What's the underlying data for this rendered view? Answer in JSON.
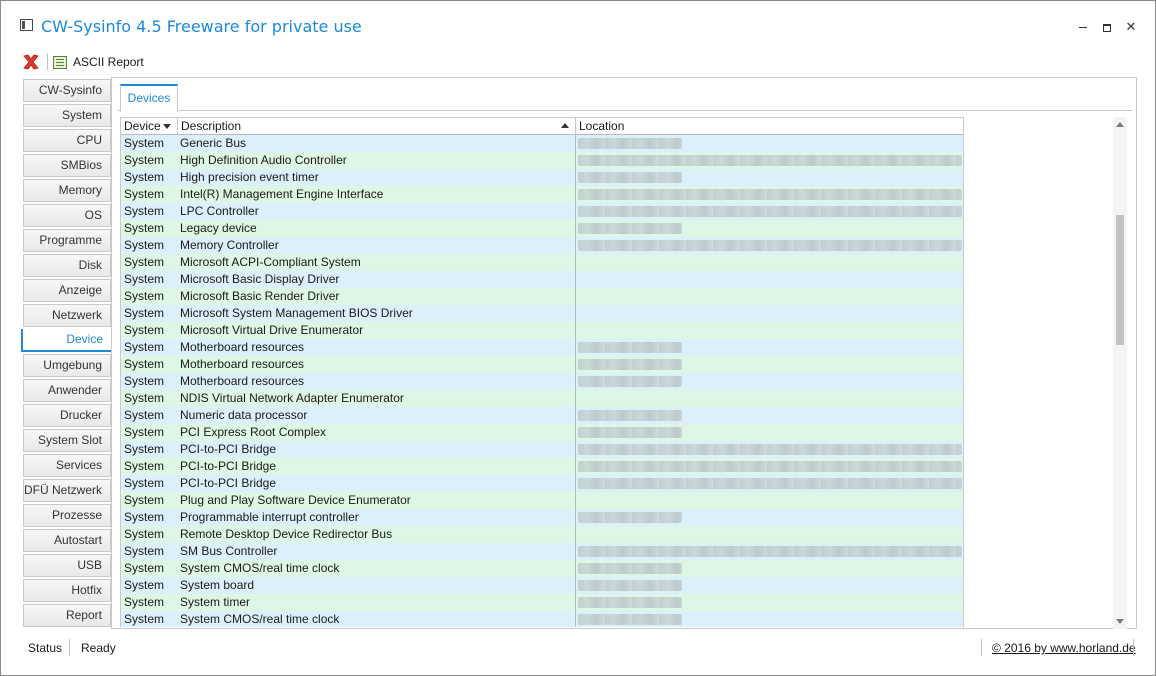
{
  "window": {
    "title": "CW-Sysinfo 4.5 Freeware for private use"
  },
  "toolbar": {
    "report_label": "ASCII Report"
  },
  "sidebar": {
    "items": [
      {
        "label": "CW-Sysinfo"
      },
      {
        "label": "System"
      },
      {
        "label": "CPU"
      },
      {
        "label": "SMBios"
      },
      {
        "label": "Memory"
      },
      {
        "label": "OS"
      },
      {
        "label": "Programme"
      },
      {
        "label": "Disk"
      },
      {
        "label": "Anzeige"
      },
      {
        "label": "Netzwerk"
      },
      {
        "label": "Device"
      },
      {
        "label": "Umgebung"
      },
      {
        "label": "Anwender"
      },
      {
        "label": "Drucker"
      },
      {
        "label": "System Slot"
      },
      {
        "label": "Services"
      },
      {
        "label": "DFÜ Netzwerk"
      },
      {
        "label": "Prozesse"
      },
      {
        "label": "Autostart"
      },
      {
        "label": "USB"
      },
      {
        "label": "Hotfix"
      },
      {
        "label": "Report"
      }
    ],
    "active": "Device"
  },
  "tabs": [
    {
      "label": "Devices"
    }
  ],
  "table": {
    "columns": [
      "Device",
      "Description",
      "Location"
    ],
    "rows": [
      {
        "device": "System",
        "description": "Generic Bus",
        "loc_blur": 0.27
      },
      {
        "device": "System",
        "description": "High Definition Audio Controller",
        "loc_blur": 1.0
      },
      {
        "device": "System",
        "description": "High precision event timer",
        "loc_blur": 0.27
      },
      {
        "device": "System",
        "description": "Intel(R) Management Engine Interface",
        "loc_blur": 1.0
      },
      {
        "device": "System",
        "description": "LPC Controller",
        "loc_blur": 1.0
      },
      {
        "device": "System",
        "description": "Legacy device",
        "loc_blur": 0.27
      },
      {
        "device": "System",
        "description": "Memory Controller",
        "loc_blur": 1.0
      },
      {
        "device": "System",
        "description": "Microsoft ACPI-Compliant System",
        "loc_blur": 0
      },
      {
        "device": "System",
        "description": "Microsoft Basic Display Driver",
        "loc_blur": 0
      },
      {
        "device": "System",
        "description": "Microsoft Basic Render Driver",
        "loc_blur": 0
      },
      {
        "device": "System",
        "description": "Microsoft System Management BIOS Driver",
        "loc_blur": 0
      },
      {
        "device": "System",
        "description": "Microsoft Virtual Drive Enumerator",
        "loc_blur": 0
      },
      {
        "device": "System",
        "description": "Motherboard resources",
        "loc_blur": 0.27
      },
      {
        "device": "System",
        "description": "Motherboard resources",
        "loc_blur": 0.27
      },
      {
        "device": "System",
        "description": "Motherboard resources",
        "loc_blur": 0.27
      },
      {
        "device": "System",
        "description": "NDIS Virtual Network Adapter Enumerator",
        "loc_blur": 0
      },
      {
        "device": "System",
        "description": "Numeric data processor",
        "loc_blur": 0.27
      },
      {
        "device": "System",
        "description": "PCI Express Root Complex",
        "loc_blur": 0.27
      },
      {
        "device": "System",
        "description": "PCI-to-PCI Bridge",
        "loc_blur": 1.0
      },
      {
        "device": "System",
        "description": "PCI-to-PCI Bridge",
        "loc_blur": 1.0
      },
      {
        "device": "System",
        "description": "PCI-to-PCI Bridge",
        "loc_blur": 1.0
      },
      {
        "device": "System",
        "description": "Plug and Play Software Device Enumerator",
        "loc_blur": 0
      },
      {
        "device": "System",
        "description": "Programmable interrupt controller",
        "loc_blur": 0.27
      },
      {
        "device": "System",
        "description": "Remote Desktop Device Redirector Bus",
        "loc_blur": 0
      },
      {
        "device": "System",
        "description": "SM Bus Controller",
        "loc_blur": 1.0
      },
      {
        "device": "System",
        "description": "System CMOS/real time clock",
        "loc_blur": 0.27
      },
      {
        "device": "System",
        "description": "System board",
        "loc_blur": 0.27
      },
      {
        "device": "System",
        "description": "System timer",
        "loc_blur": 0.27
      },
      {
        "device": "System",
        "description": "System CMOS/real time clock",
        "loc_blur": 0.27
      }
    ]
  },
  "statusbar": {
    "label": "Status",
    "value": "Ready",
    "link": "© 2016 by www.horland.de"
  },
  "colors": {
    "accent": "#1c8ad8",
    "row_odd": "#dcf0fb",
    "row_even": "#ddf7e4"
  }
}
